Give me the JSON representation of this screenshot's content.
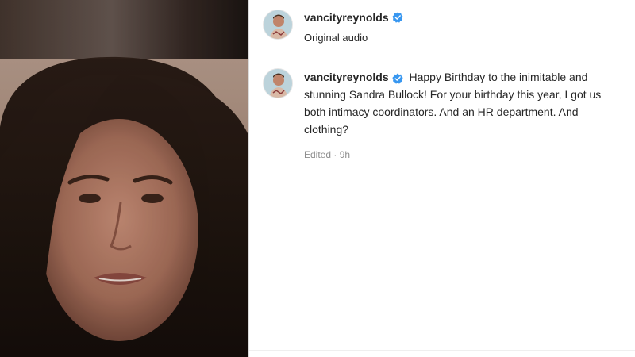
{
  "post": {
    "author": {
      "username": "vancityreynolds",
      "verified": true
    },
    "audio_label": "Original audio",
    "caption": {
      "username": "vancityreynolds",
      "text": "Happy Birthday to the inimitable and stunning Sandra Bullock! For your birthday this year, I got us both intimacy coordinators. And an HR department. And clothing?",
      "meta": "Edited · 9h"
    }
  },
  "colors": {
    "verified_badge": "#3897f0",
    "text_primary": "#262626",
    "text_secondary": "#8e8e8e",
    "divider": "#dbdbdb"
  },
  "icons": {
    "verified": "verified-badge-icon"
  }
}
